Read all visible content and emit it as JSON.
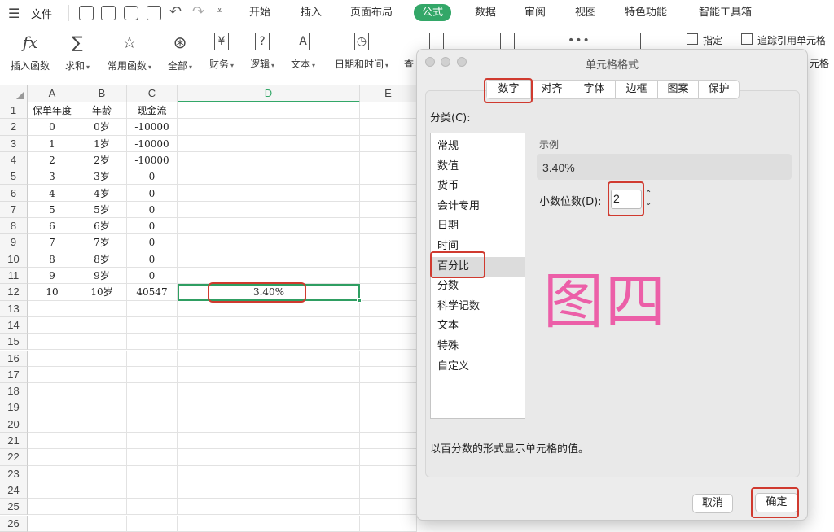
{
  "menubar": {
    "file": "文件",
    "tabs": [
      "开始",
      "插入",
      "页面布局",
      "公式",
      "数据",
      "审阅",
      "视图",
      "特色功能",
      "智能工具箱"
    ],
    "active_tab": "公式",
    "accent": "#33a768"
  },
  "ribbon": {
    "items": [
      {
        "icon": "fx",
        "label": "插入函数"
      },
      {
        "icon": "∑",
        "label": "求和"
      },
      {
        "icon": "☆",
        "label": "常用函数"
      },
      {
        "icon": "⊛",
        "label": "全部"
      },
      {
        "icon": "¥",
        "label": "财务"
      },
      {
        "icon": "?",
        "label": "逻辑"
      },
      {
        "icon": "A",
        "label": "文本"
      },
      {
        "icon": "◷",
        "label": "日期和时间"
      }
    ],
    "cut_label": "查",
    "right_specify": "指定",
    "right_trace": "追踪引用单元格",
    "right_trace_cut": "元格"
  },
  "sheet": {
    "columns": [
      "A",
      "B",
      "C",
      "D",
      "E"
    ],
    "rows": [
      "1",
      "2",
      "3",
      "4",
      "5",
      "6",
      "7",
      "8",
      "9",
      "10",
      "11",
      "12",
      "13",
      "14",
      "15",
      "16",
      "17",
      "18",
      "19",
      "20",
      "21",
      "22",
      "23",
      "24",
      "25",
      "26"
    ],
    "data": [
      [
        "保单年度",
        "年龄",
        "现金流"
      ],
      [
        "0",
        "0岁",
        "-10000"
      ],
      [
        "1",
        "1岁",
        "-10000"
      ],
      [
        "2",
        "2岁",
        "-10000"
      ],
      [
        "3",
        "3岁",
        "0"
      ],
      [
        "4",
        "4岁",
        "0"
      ],
      [
        "5",
        "5岁",
        "0"
      ],
      [
        "6",
        "6岁",
        "0"
      ],
      [
        "7",
        "7岁",
        "0"
      ],
      [
        "8",
        "8岁",
        "0"
      ],
      [
        "9",
        "9岁",
        "0"
      ],
      [
        "10",
        "10岁",
        "40547"
      ]
    ],
    "d12_value": "3.40%"
  },
  "dialog": {
    "title": "单元格格式",
    "tabs": [
      "数字",
      "对齐",
      "字体",
      "边框",
      "图案",
      "保护"
    ],
    "category_label": "分类(C):",
    "categories": [
      "常规",
      "数值",
      "货币",
      "会计专用",
      "日期",
      "时间",
      "百分比",
      "分数",
      "科学记数",
      "文本",
      "特殊",
      "自定义"
    ],
    "selected_category": "百分比",
    "sample_label": "示例",
    "sample_value": "3.40%",
    "decimal_label": "小数位数(D):",
    "decimal_value": "2",
    "description": "以百分数的形式显示单元格的值。",
    "cancel": "取消",
    "ok": "确定",
    "watermark": "图四",
    "highlight_color": "#d03a2f",
    "watermark_color": "#ec5fa8"
  }
}
